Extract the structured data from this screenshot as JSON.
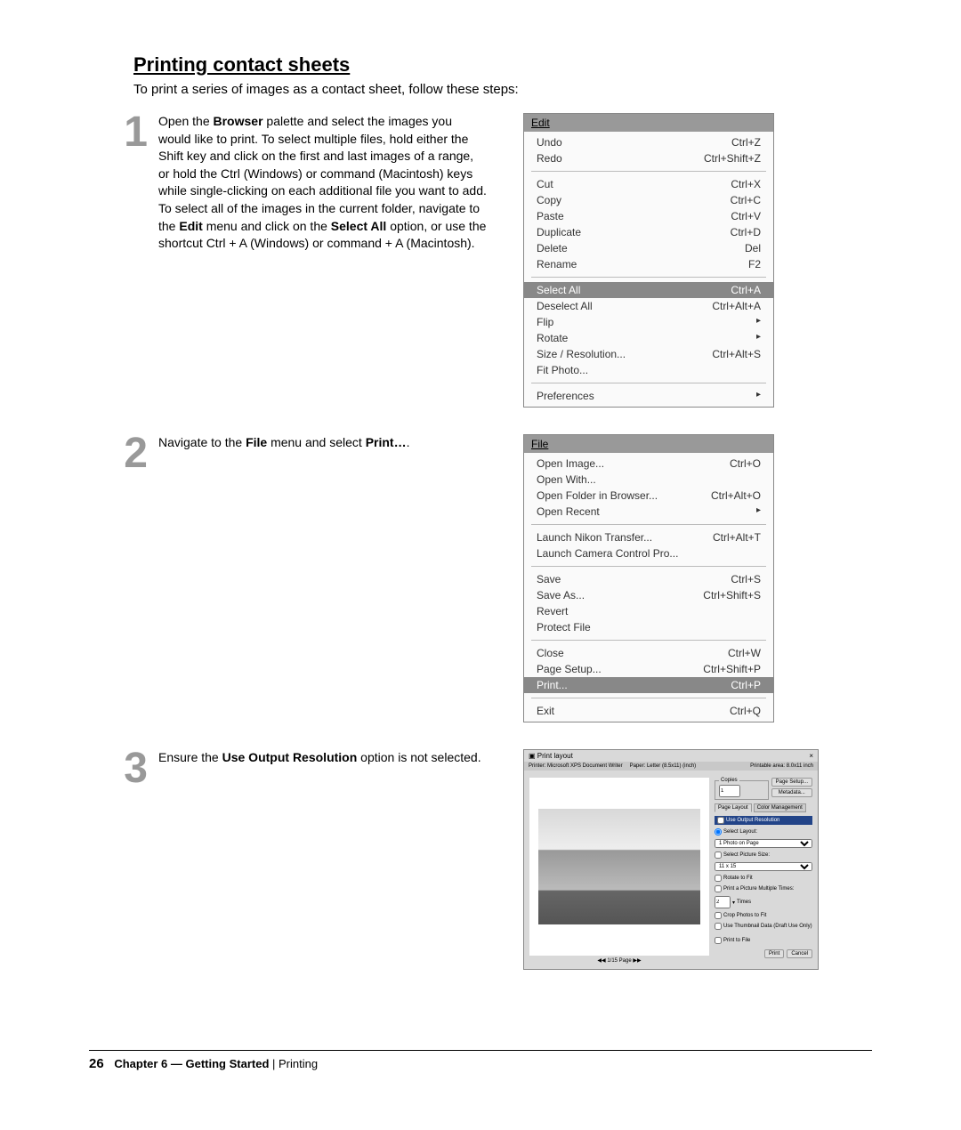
{
  "title": "Printing contact sheets",
  "intro": "To print a series of images as a contact sheet, follow these steps:",
  "steps": {
    "s1": {
      "num": "1",
      "text_parts": [
        "Open the ",
        "Browser",
        " palette and select the images you would like to print. To select multiple files, hold either the Shift key and click on the first and last images of a range, or hold the Ctrl (Windows) or command (Macintosh) keys while single-clicking on each additional file you want to add. To select all of the images in the current folder, navigate to the ",
        "Edit",
        " menu and click on the ",
        "Select All",
        " option, or use the shortcut Ctrl + A (Windows) or command + A (Macintosh)."
      ]
    },
    "s2": {
      "num": "2",
      "text_parts": [
        "Navigate to the ",
        "File",
        " menu and select ",
        "Print…",
        "."
      ]
    },
    "s3": {
      "num": "3",
      "text_parts": [
        "Ensure the ",
        "Use Output Resolution",
        " option is not selected."
      ]
    }
  },
  "editmenu": {
    "title": "Edit",
    "items": [
      {
        "l": "Undo",
        "s": "Ctrl+Z"
      },
      {
        "l": "Redo",
        "s": "Ctrl+Shift+Z"
      },
      {
        "hr": true
      },
      {
        "l": "Cut",
        "s": "Ctrl+X"
      },
      {
        "l": "Copy",
        "s": "Ctrl+C"
      },
      {
        "l": "Paste",
        "s": "Ctrl+V"
      },
      {
        "l": "Duplicate",
        "s": "Ctrl+D"
      },
      {
        "l": "Delete",
        "s": "Del"
      },
      {
        "l": "Rename",
        "s": "F2"
      },
      {
        "hr": true
      },
      {
        "l": "Select All",
        "s": "Ctrl+A",
        "sel": true
      },
      {
        "l": "Deselect All",
        "s": "Ctrl+Alt+A"
      },
      {
        "l": "Flip",
        "s": "▸"
      },
      {
        "l": "Rotate",
        "s": "▸"
      },
      {
        "l": "Size / Resolution...",
        "s": "Ctrl+Alt+S"
      },
      {
        "l": "Fit Photo...",
        "s": ""
      },
      {
        "hr": true
      },
      {
        "l": "Preferences",
        "s": "▸"
      }
    ]
  },
  "filemenu": {
    "title": "File",
    "items": [
      {
        "l": "Open Image...",
        "s": "Ctrl+O"
      },
      {
        "l": "Open With...",
        "s": ""
      },
      {
        "l": "Open Folder in Browser...",
        "s": "Ctrl+Alt+O"
      },
      {
        "l": "Open Recent",
        "s": "▸"
      },
      {
        "hr": true
      },
      {
        "l": "Launch Nikon Transfer...",
        "s": "Ctrl+Alt+T"
      },
      {
        "l": "Launch Camera Control Pro...",
        "s": ""
      },
      {
        "hr": true
      },
      {
        "l": "Save",
        "s": "Ctrl+S"
      },
      {
        "l": "Save As...",
        "s": "Ctrl+Shift+S"
      },
      {
        "l": "Revert",
        "s": ""
      },
      {
        "l": "Protect File",
        "s": ""
      },
      {
        "hr": true
      },
      {
        "l": "Close",
        "s": "Ctrl+W"
      },
      {
        "l": "Page Setup...",
        "s": "Ctrl+Shift+P"
      },
      {
        "l": "Print...",
        "s": "Ctrl+P",
        "sel": true
      },
      {
        "hr": true
      },
      {
        "l": "Exit",
        "s": "Ctrl+Q"
      }
    ]
  },
  "printdlg": {
    "title": "Print layout",
    "close": "×",
    "printer": "Printer: Microsoft XPS Document Writer",
    "paper": "Paper: Letter (8.5x11) (inch)",
    "area": "Printable area: 8.0x11 inch",
    "pager": "◀◀   1/15 Page   ▶▶",
    "copies_label": "Copies",
    "copies_val": "1",
    "pagesetup": "Page Setup...",
    "metadata": "Metadata...",
    "tab1": "Page Layout",
    "tab2": "Color Management",
    "useoutres": "Use Output Resolution",
    "sellayout": "Select Layout:",
    "layoutopt": "1 Photo on Page",
    "selpicsize": "Select Picture Size:",
    "picsizeopt": "11 x 15",
    "rotate": "Rotate to Fit",
    "printmult": "Print a Picture Multiple Times:",
    "multval": "2",
    "multtimes": "Times",
    "crop": "Crop Photos to Fit",
    "usethumb": "Use Thumbnail Data (Draft Use Only)",
    "printfile": "Print to File",
    "printbtn": "Print",
    "cancelbtn": "Cancel"
  },
  "footer": {
    "pagenum": "26",
    "chapter": "Chapter 6 — Getting Started",
    "section": "Printing"
  }
}
